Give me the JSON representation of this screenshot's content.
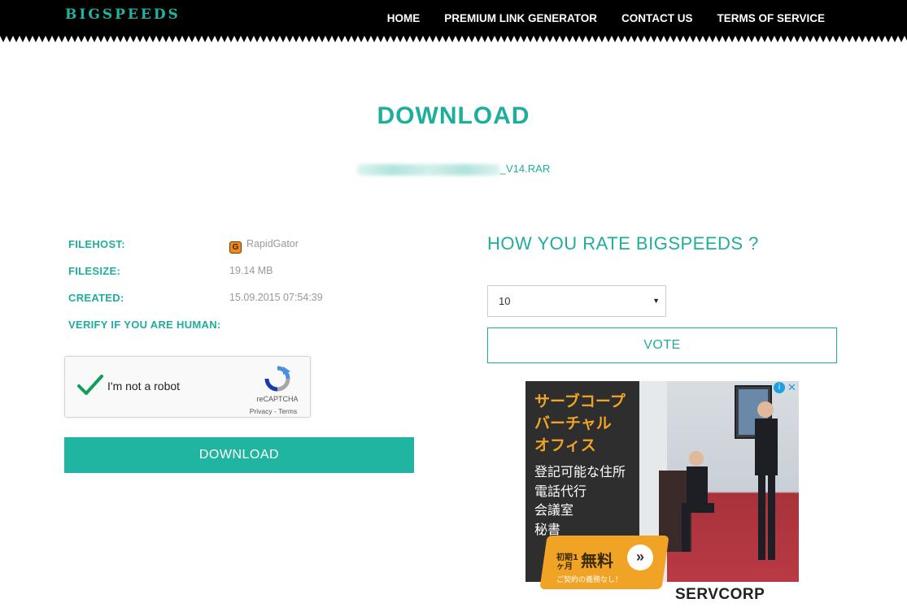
{
  "header": {
    "logo": "BIGSPEEDS",
    "nav": [
      "HOME",
      "PREMIUM LINK GENERATOR",
      "CONTACT US",
      "TERMS OF SERVICE"
    ]
  },
  "page": {
    "title": "DOWNLOAD",
    "file_name_suffix": "_V14.RAR"
  },
  "file_info": {
    "filehost_label": "FILEHOST:",
    "filehost_value": "RapidGator",
    "filehost_icon": "rapidgator-icon",
    "filesize_label": "FILESIZE:",
    "filesize_value": "19.14 MB",
    "created_label": "CREATED:",
    "created_value": "15.09.2015 07:54:39",
    "verify_label": "VERIFY IF YOU ARE HUMAN:"
  },
  "captcha": {
    "label": "I'm not a robot",
    "brand": "reCAPTCHA",
    "links": "Privacy - Terms",
    "checked": true
  },
  "download_button": "DOWNLOAD",
  "rating": {
    "title": "HOW YOU RATE BIGSPEEDS ?",
    "selected": "10",
    "vote_button": "VOTE"
  },
  "ad": {
    "title_lines": [
      "サーブコープ",
      "バーチャル",
      "オフィス"
    ],
    "service_lines": [
      "登記可能な住所",
      "電話代行",
      "会議室",
      "秘書"
    ],
    "badge_prefix": "初期1ヶ月",
    "badge_main": "無料",
    "badge_sub": "ご契約の義務なし！",
    "brand": "SERVCORP"
  },
  "colors": {
    "accent": "#1fb5a0",
    "header_bg": "#000000",
    "ad_orange": "#f0a325"
  }
}
